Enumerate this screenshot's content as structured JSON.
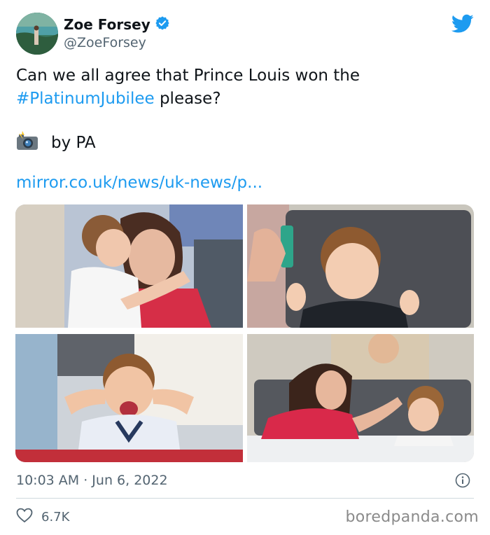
{
  "tweet": {
    "author_name": "Zoe Forsey",
    "author_handle": "@ZoeForsey",
    "verified": true,
    "text_before": "Can we all agree that Prince Louis won the ",
    "hashtag": "#PlatinumJubilee",
    "text_after": " please?",
    "credit_text": "by PA",
    "link_text": "mirror.co.uk/news/uk-news/p...",
    "timestamp": "10:03 AM · Jun 6, 2022",
    "like_count": "6.7K"
  },
  "icons": {
    "verified": "verified-badge-icon",
    "twitter": "twitter-bird-icon",
    "camera": "camera-flash-icon",
    "info": "info-icon",
    "like": "heart-icon"
  },
  "colors": {
    "link": "#1d9bf0",
    "text": "#0f1419",
    "secondary": "#536471",
    "divider": "#cfd9de"
  },
  "watermark": "boredpanda.com"
}
